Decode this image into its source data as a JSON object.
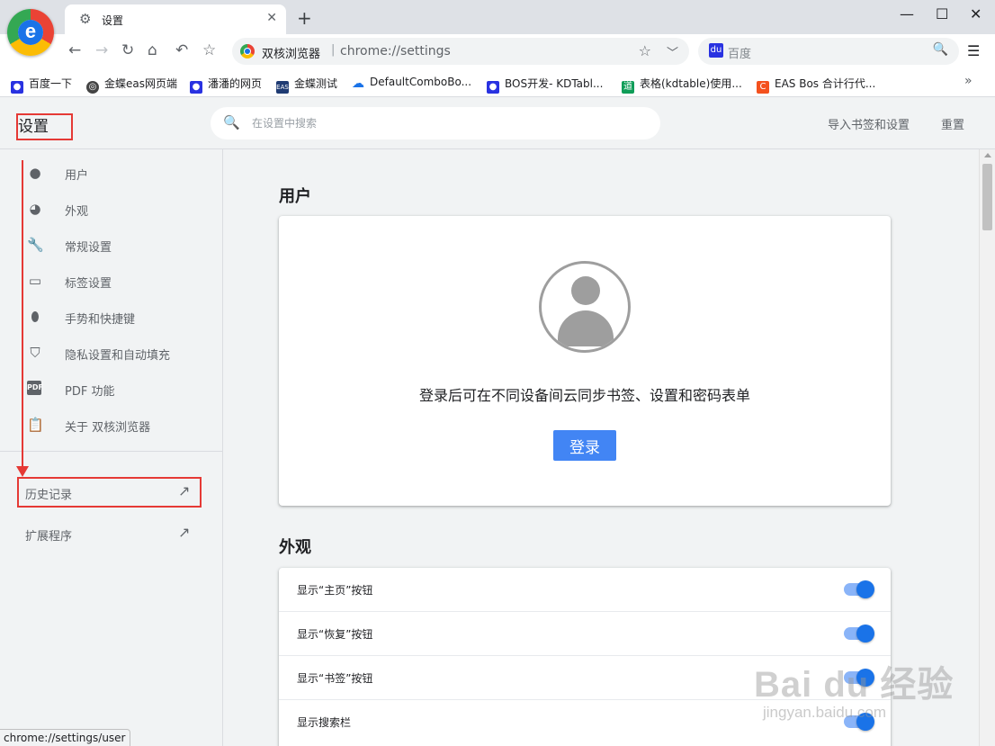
{
  "browser": {
    "tab_icon": "gear-icon",
    "tab_title": "设置",
    "tab_close": "✕",
    "new_tab": "+",
    "window_controls": {
      "minimize": "—",
      "maximize": "☐",
      "close": "✕"
    },
    "site_name": "双核浏览器",
    "url": "chrome://settings",
    "search_engine_placeholder": "百度",
    "accent_color": "#1a73e8"
  },
  "bookmarks": [
    {
      "label": "百度一下",
      "icon": "paw-icon"
    },
    {
      "label": "金蝶eas网页端",
      "icon": "globe-icon"
    },
    {
      "label": "潘潘的网页",
      "icon": "paw-icon"
    },
    {
      "label": "金蝶测试",
      "icon": "eas-icon"
    },
    {
      "label": "DefaultComboBo...",
      "icon": "cloud-icon"
    },
    {
      "label": "BOS开发- KDTabl...",
      "icon": "paw-icon"
    },
    {
      "label": "表格(kdtable)使用...",
      "icon": "doc-icon"
    },
    {
      "label": "EAS Bos 合计行代...",
      "icon": "c-icon"
    }
  ],
  "header": {
    "title": "设置",
    "search_placeholder": "在设置中搜索",
    "import_label": "导入书签和设置",
    "reset_label": "重置"
  },
  "sidebar": {
    "items": [
      {
        "label": "用户",
        "icon": "person-icon"
      },
      {
        "label": "外观",
        "icon": "palette-icon"
      },
      {
        "label": "常规设置",
        "icon": "wrench-icon"
      },
      {
        "label": "标签设置",
        "icon": "tab-icon"
      },
      {
        "label": "手势和快捷键",
        "icon": "mouse-icon"
      },
      {
        "label": "隐私设置和自动填充",
        "icon": "shield-icon"
      },
      {
        "label": "PDF 功能",
        "icon": "pdf-icon"
      },
      {
        "label": "关于 双核浏览器",
        "icon": "clipboard-icon"
      }
    ],
    "links": [
      {
        "label": "历史记录",
        "icon": "external-link-icon"
      },
      {
        "label": "扩展程序",
        "icon": "external-link-icon"
      }
    ]
  },
  "main": {
    "user_section_title": "用户",
    "sync_text": "登录后可在不同设备间云同步书签、设置和密码表单",
    "signin_label": "登录",
    "appearance_section_title": "外观",
    "appearance_rows": [
      {
        "label": "显示“主页”按钮",
        "enabled": true
      },
      {
        "label": "显示“恢复”按钮",
        "enabled": true
      },
      {
        "label": "显示“书签”按钮",
        "enabled": true
      },
      {
        "label": "显示搜索栏",
        "enabled": true
      }
    ]
  },
  "status_text": "chrome://settings/user",
  "watermark": {
    "line1": "Bai du 经验",
    "line2": "jingyan.baidu.com"
  },
  "annotation_color": "#e53935"
}
